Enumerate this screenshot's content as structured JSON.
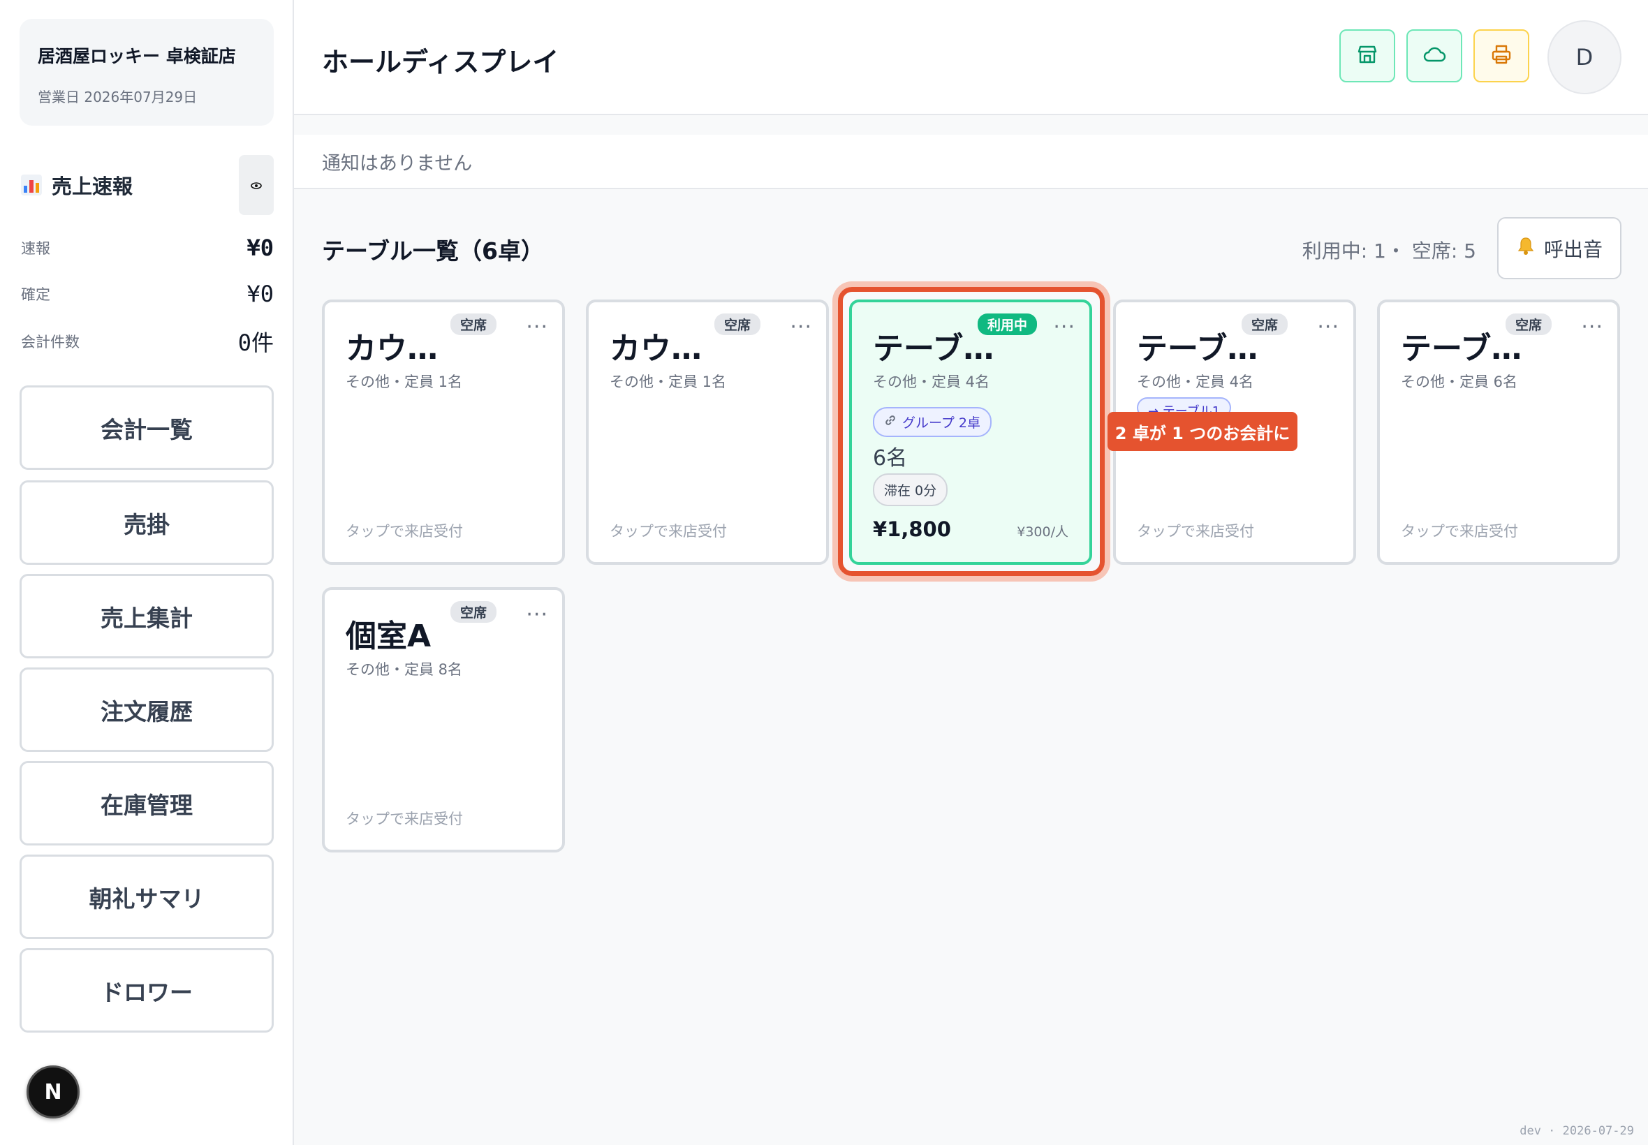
{
  "store": {
    "name": "居酒屋ロッキー 卓検証店",
    "business_date": "営業日 2026年07月29日"
  },
  "sales": {
    "title": "売上速報",
    "rows": [
      {
        "label": "速報",
        "value": "¥0"
      },
      {
        "label": "確定",
        "value": "¥0"
      },
      {
        "label": "会計件数",
        "value": "0件"
      }
    ]
  },
  "menu": [
    "会計一覧",
    "売掛",
    "売上集計",
    "注文履歴",
    "在庫管理",
    "朝礼サマリ",
    "ドロワー"
  ],
  "header": {
    "title": "ホールディスプレイ",
    "avatar": "D"
  },
  "notice": "通知はありません",
  "tables_header": {
    "title": "テーブル一覧（6卓）",
    "counts": "利用中: 1・ 空席: 5",
    "call_sound": "呼出音"
  },
  "tables": [
    {
      "name": "カウ…",
      "status": "空席",
      "sub": "その他・定員 1名",
      "tap": "タップで来店受付"
    },
    {
      "name": "カウ…",
      "status": "空席",
      "sub": "その他・定員 1名",
      "tap": "タップで来店受付"
    },
    {
      "name": "テーブ…",
      "status": "利用中",
      "sub": "その他・定員 4名",
      "group": "グループ 2卓",
      "guests": "6名",
      "stay": "滞在 0分",
      "amount": "¥1,800",
      "per_person": "¥300/人"
    },
    {
      "name": "テーブ…",
      "status": "空席",
      "sub": "その他・定員 4名",
      "link": "→ テーブル1",
      "tap": "タップで来店受付"
    },
    {
      "name": "テーブ…",
      "status": "空席",
      "sub": "その他・定員 6名",
      "tap": "タップで来店受付"
    },
    {
      "name": "個室A",
      "status": "空席",
      "sub": "その他・定員 8名",
      "tap": "タップで来店受付"
    }
  ],
  "tooltip": "2 卓が 1 つのお会計に",
  "footer": "dev · 2026-07-29",
  "icons": {
    "next": "N",
    "more": "···",
    "eye": "👁"
  },
  "colors": {
    "accent_green": "#10b981",
    "highlight_orange": "#e5532f",
    "print_amber": "#d97706"
  }
}
